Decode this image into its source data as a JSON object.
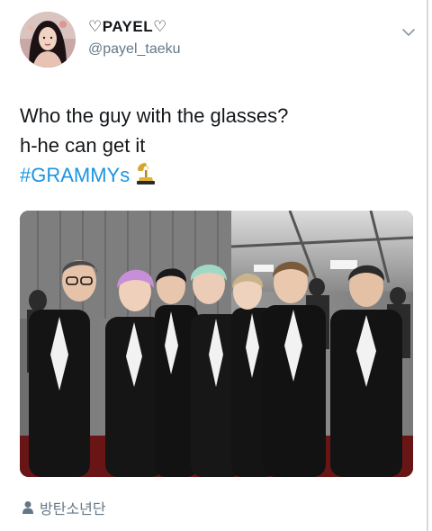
{
  "user": {
    "display_name": "♡Payel♡",
    "display_name_core": "PAYEL",
    "heart": "♡",
    "handle": "@payel_taeku"
  },
  "tweet": {
    "line1": "Who the guy with the glasses?",
    "line2": "h-he can get it",
    "hashtag": "#GRAMMYs",
    "hashtag_color": "#1b95e0",
    "trophy_icon": "grammy-trophy-icon"
  },
  "location": {
    "label": "방탄소년단",
    "icon": "person-icon"
  },
  "colors": {
    "text": "#14171a",
    "muted": "#657786",
    "link": "#1b95e0"
  }
}
